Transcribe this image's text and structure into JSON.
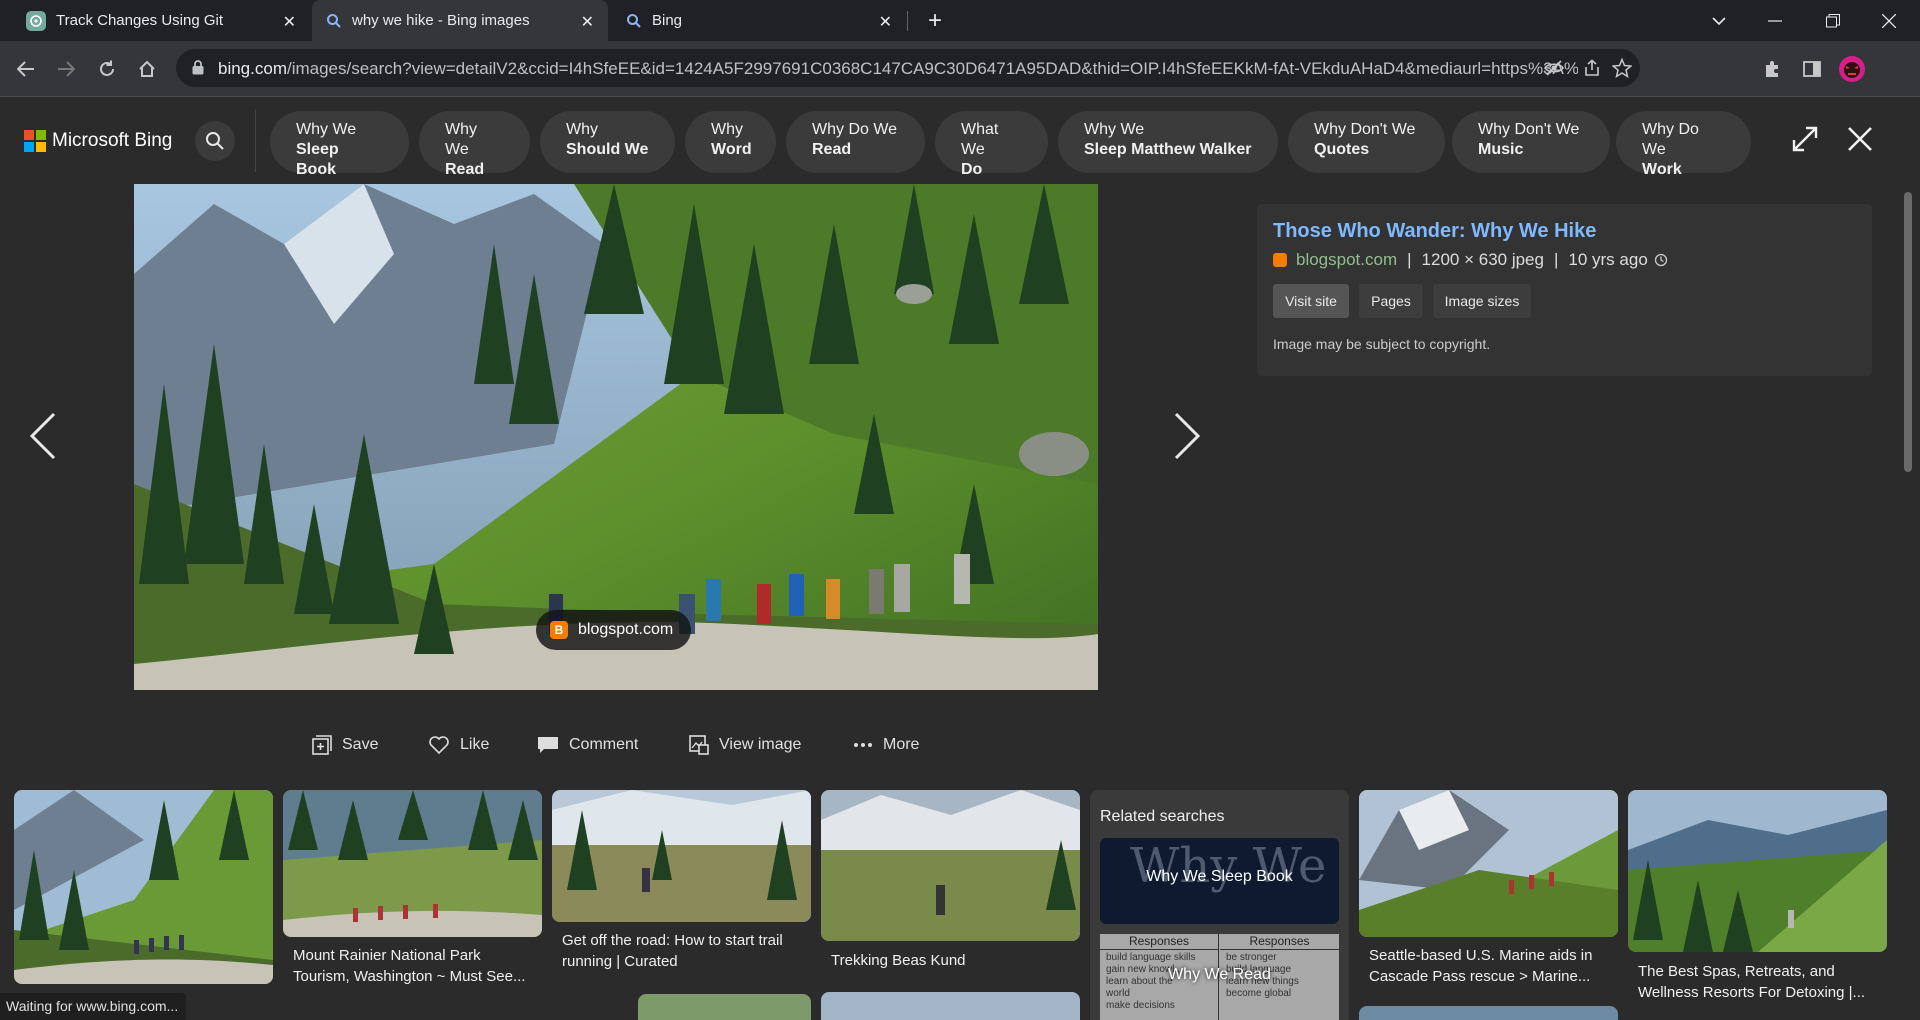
{
  "browser": {
    "tabs": [
      {
        "title": "Track Changes Using Git",
        "icon": "chatgpt-icon",
        "active": false
      },
      {
        "title": "why we hike - Bing images",
        "icon": "search-icon",
        "active": true
      },
      {
        "title": "Bing",
        "icon": "search-icon",
        "active": false
      }
    ],
    "url_domain": "bing.com",
    "url_rest": "/images/search?view=detailV2&ccid=I4hSfeEE&id=1424A5F2997691C0368C147CA9C30D6471A95DAD&thid=OIP.I4hSfeEEKkM-fAt-VEkduAHaD4&mediaurl=https%3A%2...",
    "status": "Waiting for www.bing.com..."
  },
  "bing": {
    "logo_text": "Microsoft Bing",
    "suggestions": [
      {
        "l1": "Why We",
        "l2": "Sleep Book"
      },
      {
        "l1": "Why We",
        "l2": "Read"
      },
      {
        "l1": "Why",
        "l2": "Should We"
      },
      {
        "l1": "Why",
        "l2": "Word"
      },
      {
        "l1": "Why Do We",
        "l2": "Read"
      },
      {
        "l1": "What We",
        "l2": "Do"
      },
      {
        "l1": "Why We",
        "l2": "Sleep Matthew Walker"
      },
      {
        "l1": "Why Don't We",
        "l2": "Quotes"
      },
      {
        "l1": "Why Don't We",
        "l2": "Music"
      },
      {
        "l1": "Why Do We",
        "l2": "Work"
      }
    ]
  },
  "detail": {
    "source_badge": "blogspot.com",
    "title": "Those Who Wander: Why We Hike",
    "source": "blogspot.com",
    "dims": "1200 × 630 jpeg",
    "age": "10 yrs ago",
    "buttons": [
      "Visit site",
      "Pages",
      "Image sizes"
    ],
    "copyright": "Image may be subject to copyright.",
    "actions": [
      "Save",
      "Like",
      "Comment",
      "View image",
      "More"
    ]
  },
  "related": {
    "title": "Related searches",
    "items": [
      "Why We Sleep Book",
      "Why We Read"
    ],
    "book_title_art": "Why We",
    "responses_header": "Responses",
    "responses_left": [
      "build language skills",
      "gain new knowl...",
      "learn about the",
      "world",
      "make decisions"
    ],
    "responses_right": [
      "be stronger",
      "build language",
      "learn new things",
      "become global"
    ]
  },
  "thumbs": [
    {
      "caption": ""
    },
    {
      "caption": "Mount Rainier National Park Tourism, Washington ~ Must See..."
    },
    {
      "caption": "Get off the road: How to start trail running | Curated"
    },
    {
      "caption": "Trekking Beas Kund"
    },
    {
      "caption": "Seattle-based U.S. Marine aids in Cascade Pass rescue > Marine..."
    },
    {
      "caption": "The Best Spas, Retreats, and Wellness Resorts For Detoxing |..."
    }
  ],
  "colors": {
    "accent_link": "#7fb9ff",
    "chip_bg": "#3b3b3b",
    "page_bg": "#2b2b2b",
    "blogger_orange": "#f57d00"
  }
}
